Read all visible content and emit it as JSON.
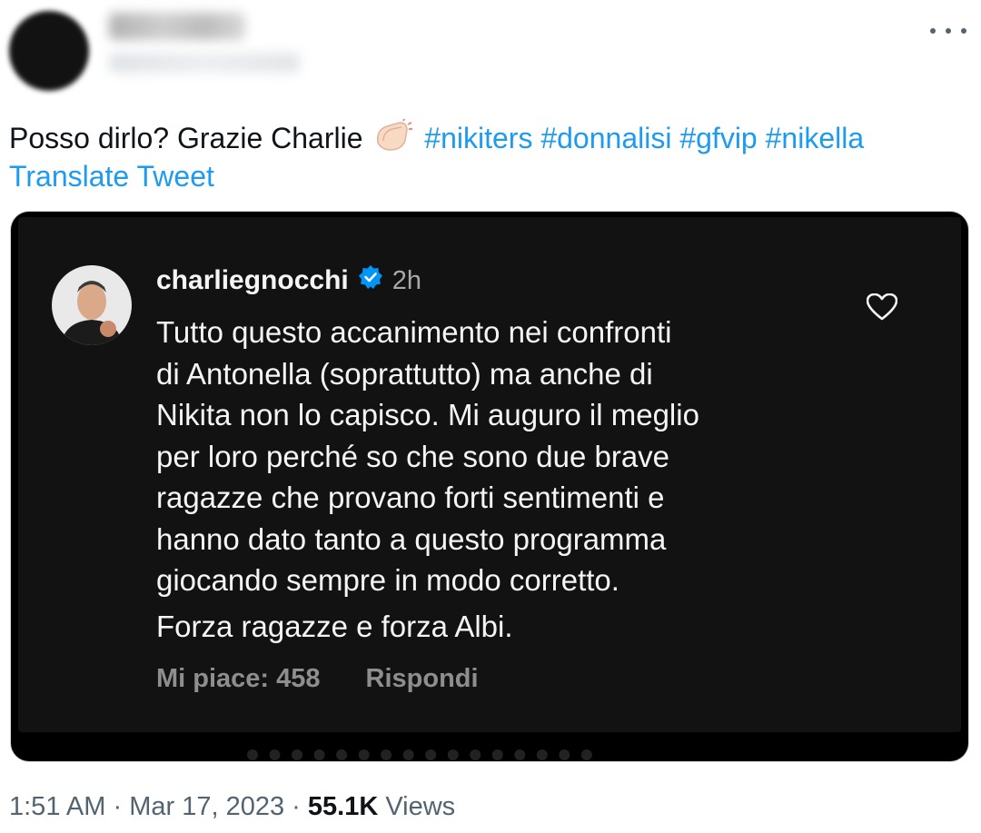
{
  "tweet": {
    "text": "Posso dirlo? Grazie Charlie",
    "emoji_icon": "clapping-hands-icon",
    "hashtags": [
      "#nikiters",
      "#donnalisi",
      "#gfvip",
      "#nikella"
    ],
    "translate_label": "Translate Tweet"
  },
  "embedded_post": {
    "username": "charliegnocchi",
    "verified_icon": "verified-badge-icon",
    "time": "2h",
    "body": "Tutto questo accanimento nei confronti di Antonella (soprattutto) ma anche di Nikita non lo capisco. Mi auguro il meglio per loro perché so che sono due brave ragazze che provano forti sentimenti e hanno dato tanto a questo programma giocando sempre in modo corretto.",
    "body_lines": [
      "Tutto questo accanimento nei confronti",
      "di Antonella (soprattutto) ma anche di",
      "Nikita non lo capisco. Mi auguro il meglio",
      "per loro perché so che sono due brave",
      "ragazze che provano forti sentimenti e",
      "hanno dato tanto a questo programma",
      "giocando sempre in modo corretto."
    ],
    "body_2": "Forza ragazze e forza Albi.",
    "likes_label": "Mi piace: 458",
    "reply_label": "Rispondi"
  },
  "meta": {
    "time": "1:51 AM",
    "separator": "·",
    "date": "Mar 17, 2023",
    "views_count": "55.1K",
    "views_label": "Views"
  },
  "colors": {
    "accent": "#1d9bf0",
    "text": "#0f1419",
    "muted": "#536471",
    "post_bg": "#121212"
  }
}
